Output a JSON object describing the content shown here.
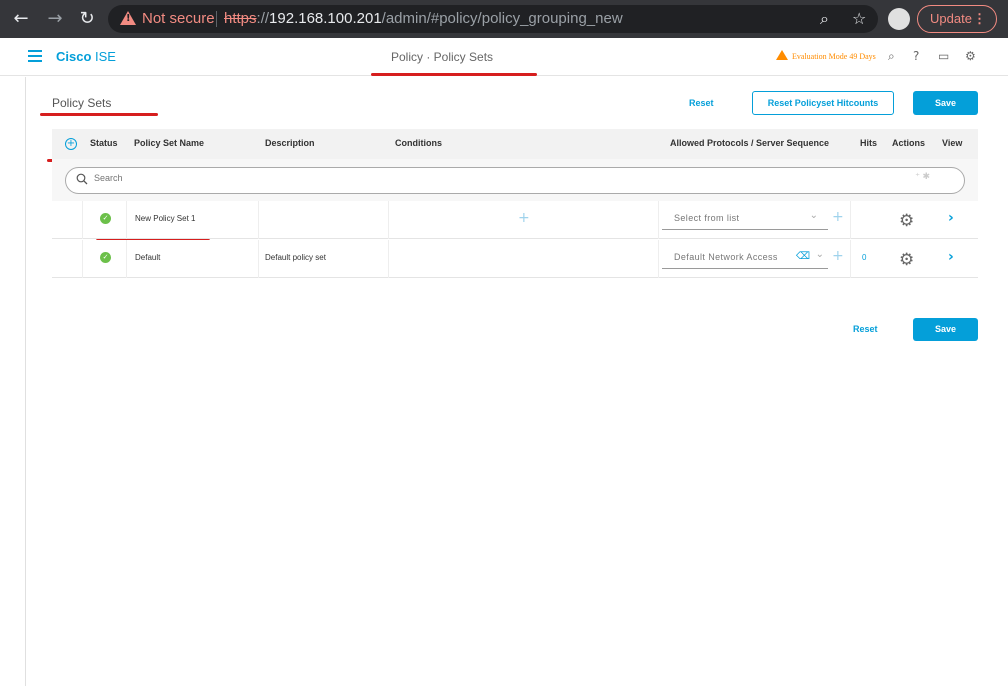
{
  "browser": {
    "not_secure": "Not secure",
    "url_scheme": "https",
    "url_sep": "://",
    "url_host": "192.168.100.201",
    "url_path": "/admin/#policy/policy_grouping_new",
    "update_label": "Update",
    "update_menu": "⋮"
  },
  "header": {
    "brand_bold": "Cisco",
    "brand_rest": " ISE",
    "page_title": "Policy · Policy Sets",
    "evaluation": "Evaluation Mode 49 Days"
  },
  "page": {
    "title": "Policy Sets",
    "reset_label": "Reset",
    "reset_hitcounts_label": "Reset Policyset Hitcounts",
    "save_label": "Save"
  },
  "table": {
    "columns": [
      "Status",
      "Policy Set Name",
      "Description",
      "Conditions",
      "Allowed Protocols / Server Sequence",
      "Hits",
      "Actions",
      "View"
    ],
    "search_placeholder": "Search",
    "search_hint": "⁺ ✱",
    "rows": [
      {
        "name": "New Policy Set 1",
        "description": "",
        "protocols": "Select from list",
        "hits": ""
      },
      {
        "name": "Default",
        "description": "Default policy set",
        "protocols": "Default Network Access",
        "hits": "0"
      }
    ]
  },
  "footer": {
    "reset_label": "Reset",
    "save_label": "Save"
  },
  "colors": {
    "accent": "#049fd9",
    "annotation": "#d61e1e",
    "status_ok": "#6cc04a",
    "warning": "#ff8c00"
  },
  "icons": [
    "back-icon",
    "forward-icon",
    "reload-icon",
    "warning-icon",
    "zoom-icon",
    "star-icon",
    "profile-icon",
    "hamburger-icon",
    "search-icon",
    "help-icon",
    "monitor-icon",
    "gear-icon",
    "add-icon",
    "check-icon",
    "chevron-down-icon",
    "chevron-right-icon"
  ]
}
